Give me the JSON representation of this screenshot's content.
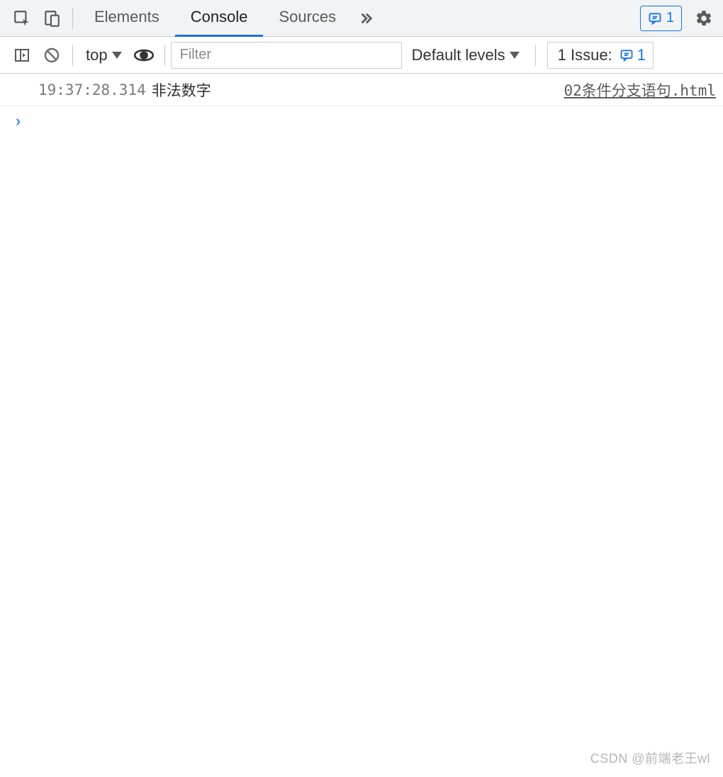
{
  "tabs": {
    "elements": "Elements",
    "console": "Console",
    "sources": "Sources"
  },
  "badges": {
    "messages_count": "1"
  },
  "console_toolbar": {
    "context": "top",
    "filter_placeholder": "Filter",
    "levels_label": "Default levels",
    "issues_label": "1 Issue:",
    "issues_count": "1"
  },
  "log": {
    "timestamp": "19:37:28.314",
    "message": "非法数字",
    "source": "02条件分支语句.html"
  },
  "watermark": "CSDN @前端老王wl"
}
